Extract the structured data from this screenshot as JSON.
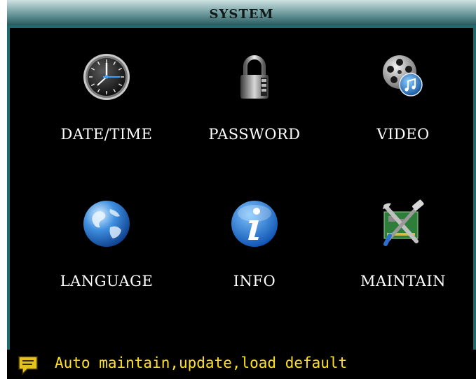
{
  "window": {
    "title": "SYSTEM"
  },
  "menu": {
    "items": [
      {
        "label": "DATE/TIME",
        "icon": "clock-icon"
      },
      {
        "label": "PASSWORD",
        "icon": "padlock-icon"
      },
      {
        "label": "VIDEO",
        "icon": "film-reel-icon"
      },
      {
        "label": "LANGUAGE",
        "icon": "globe-icon"
      },
      {
        "label": "INFO",
        "icon": "info-icon"
      },
      {
        "label": "MAINTAIN",
        "icon": "tools-icon"
      }
    ]
  },
  "status": {
    "icon": "message-icon",
    "text": "Auto maintain,update,load default",
    "color": "#ffe21a"
  },
  "colors": {
    "titlebar": "#4d7e82",
    "frame": "#1f6a6f",
    "background": "#000000",
    "label": "#ffffff"
  }
}
